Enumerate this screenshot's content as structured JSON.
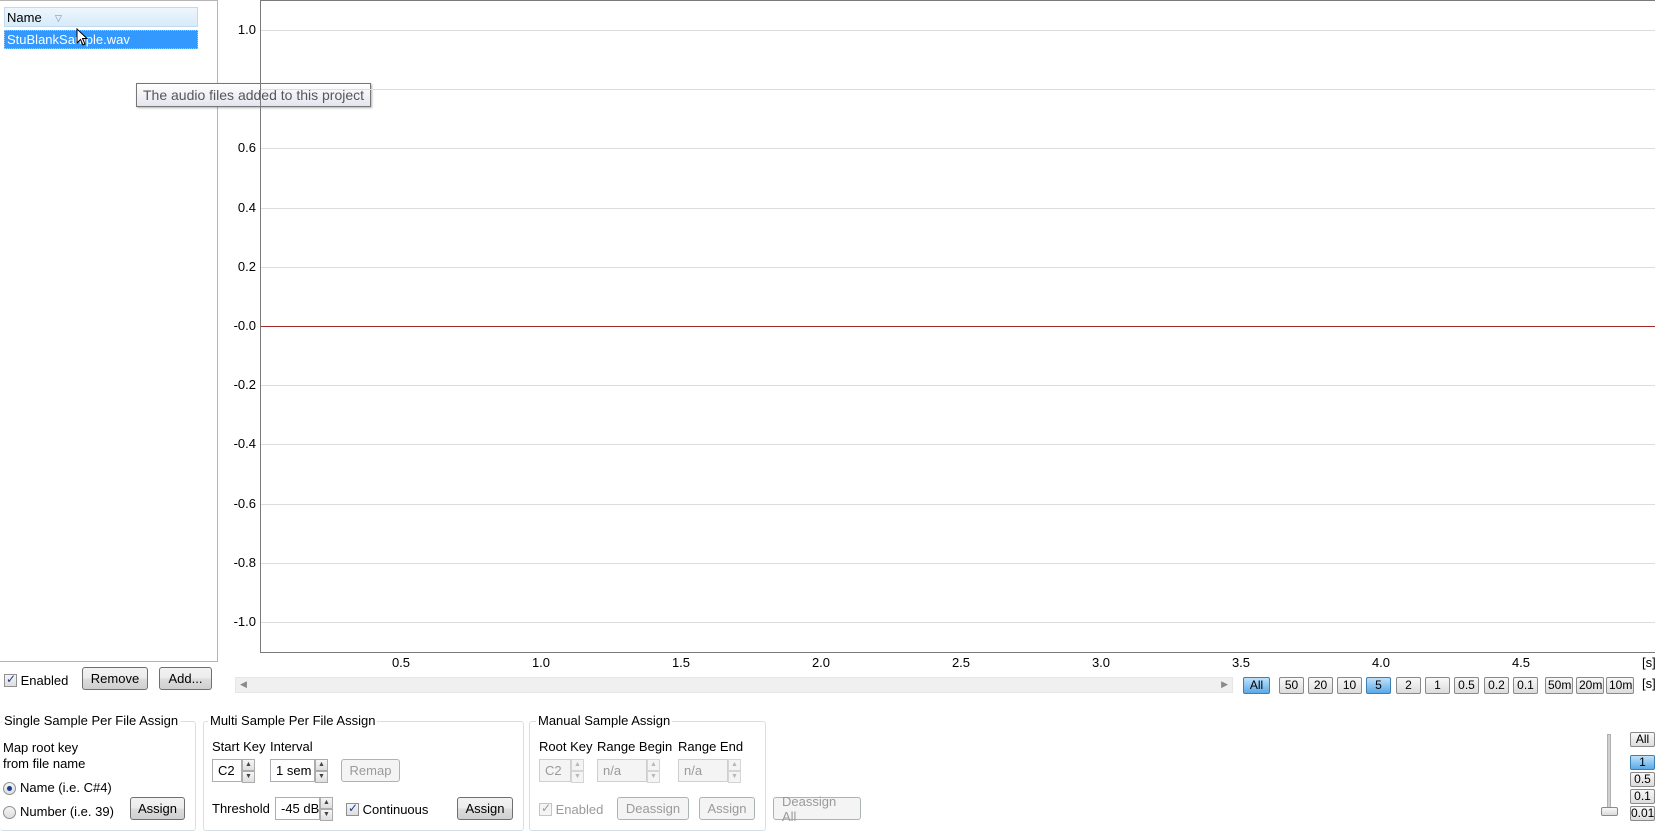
{
  "file_list": {
    "column_header": "Name",
    "items": [
      "StuBlankSample.wav"
    ],
    "tooltip": "The audio files added to this project",
    "enabled_label": "Enabled",
    "remove_label": "Remove",
    "add_label": "Add..."
  },
  "plot": {
    "y_ticks": [
      "1.0",
      "0.6",
      "0.4",
      "0.2",
      "-0.0",
      "-0.2",
      "-0.4",
      "-0.6",
      "-0.8",
      "-1.0"
    ],
    "x_ticks": [
      "0.5",
      "1.0",
      "1.5",
      "2.0",
      "2.5",
      "3.0",
      "3.5",
      "4.0",
      "4.5"
    ],
    "x_unit": "[s]",
    "y_unit": "[s]",
    "line_color": "#a52a2a",
    "h_zoom": [
      "All",
      "50",
      "20",
      "10",
      "5",
      "2",
      "1",
      "0.5",
      "0.2",
      "0.1",
      "50m",
      "20m",
      "10m"
    ],
    "h_zoom_active": "5",
    "v_zoom": [
      "All",
      "1",
      "0.5",
      "0.1",
      "0.01"
    ],
    "v_zoom_active": "1"
  },
  "single_assign": {
    "title": "Single Sample Per File Assign",
    "map_label_1": "Map root key",
    "map_label_2": "from file name",
    "radio_name": "Name (i.e. C#4)",
    "radio_number": "Number (i.e. 39)",
    "assign_label": "Assign"
  },
  "multi_assign": {
    "title": "Multi Sample Per File Assign",
    "start_key_label": "Start Key",
    "interval_label": "Interval",
    "start_key_value": "C2",
    "interval_value": "1 sem",
    "remap_label": "Remap",
    "threshold_label": "Threshold",
    "threshold_value": "-45 dB",
    "continuous_label": "Continuous",
    "assign_label": "Assign"
  },
  "manual_assign": {
    "title": "Manual Sample Assign",
    "root_key_label": "Root Key",
    "range_begin_label": "Range Begin",
    "range_end_label": "Range End",
    "root_key_value": "C2",
    "range_begin_value": "n/a",
    "range_end_value": "n/a",
    "enabled_label": "Enabled",
    "deassign_label": "Deassign",
    "assign_label": "Assign",
    "deassign_all_label": "Deassign All"
  }
}
